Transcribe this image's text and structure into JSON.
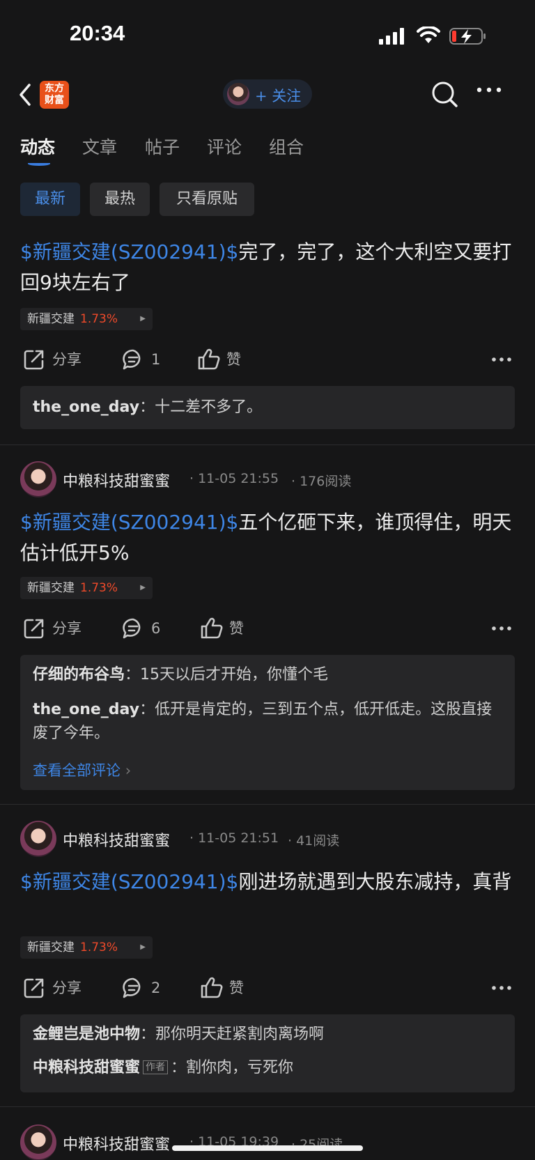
{
  "status": {
    "time": "20:34"
  },
  "nav": {
    "logo_line1": "东方",
    "logo_line2": "财富",
    "follow_label": "+ 关注"
  },
  "tabs": [
    "动态",
    "文章",
    "帖子",
    "评论",
    "组合"
  ],
  "filters": [
    "最新",
    "最热",
    "只看原贴"
  ],
  "actions": {
    "share": "分享",
    "like": "赞"
  },
  "author_tag": "作者",
  "view_all": "查看全部评论",
  "posts": [
    {
      "tag": "$新疆交建(SZ002941)$",
      "text": "完了，完了，这个大利空又要打回9块左右了",
      "stock": {
        "name": "新疆交建",
        "pct": "1.73%"
      },
      "comments_count": "1",
      "comments": [
        {
          "user": "the_one_day",
          "text": "十二差不多了。"
        }
      ]
    },
    {
      "user": "中粮科技甜蜜蜜",
      "date": "11-05 21:55",
      "reads": "176阅读",
      "tag": "$新疆交建(SZ002941)$",
      "text": "五个亿砸下来，谁顶得住，明天估计低开5%",
      "stock": {
        "name": "新疆交建",
        "pct": "1.73%"
      },
      "comments_count": "6",
      "comments": [
        {
          "user": "仔细的布谷鸟",
          "text": "15天以后才开始，你懂个毛"
        },
        {
          "user": "the_one_day",
          "text": "低开是肯定的，三到五个点，低开低走。这股直接废了今年。"
        }
      ]
    },
    {
      "user": "中粮科技甜蜜蜜",
      "date": "11-05 21:51",
      "reads": "41阅读",
      "tag": "$新疆交建(SZ002941)$",
      "text": "刚进场就遇到大股东减持，真背",
      "stock": {
        "name": "新疆交建",
        "pct": "1.73%"
      },
      "comments_count": "2",
      "comments": [
        {
          "user": "金鲤岂是池中物",
          "text": "那你明天赶紧割肉离场啊"
        },
        {
          "user": "中粮科技甜蜜蜜",
          "text": "割你肉，亏死你"
        }
      ]
    },
    {
      "user": "中粮科技甜蜜蜜",
      "date": "11-05 19:39",
      "reads": "25阅读"
    }
  ]
}
